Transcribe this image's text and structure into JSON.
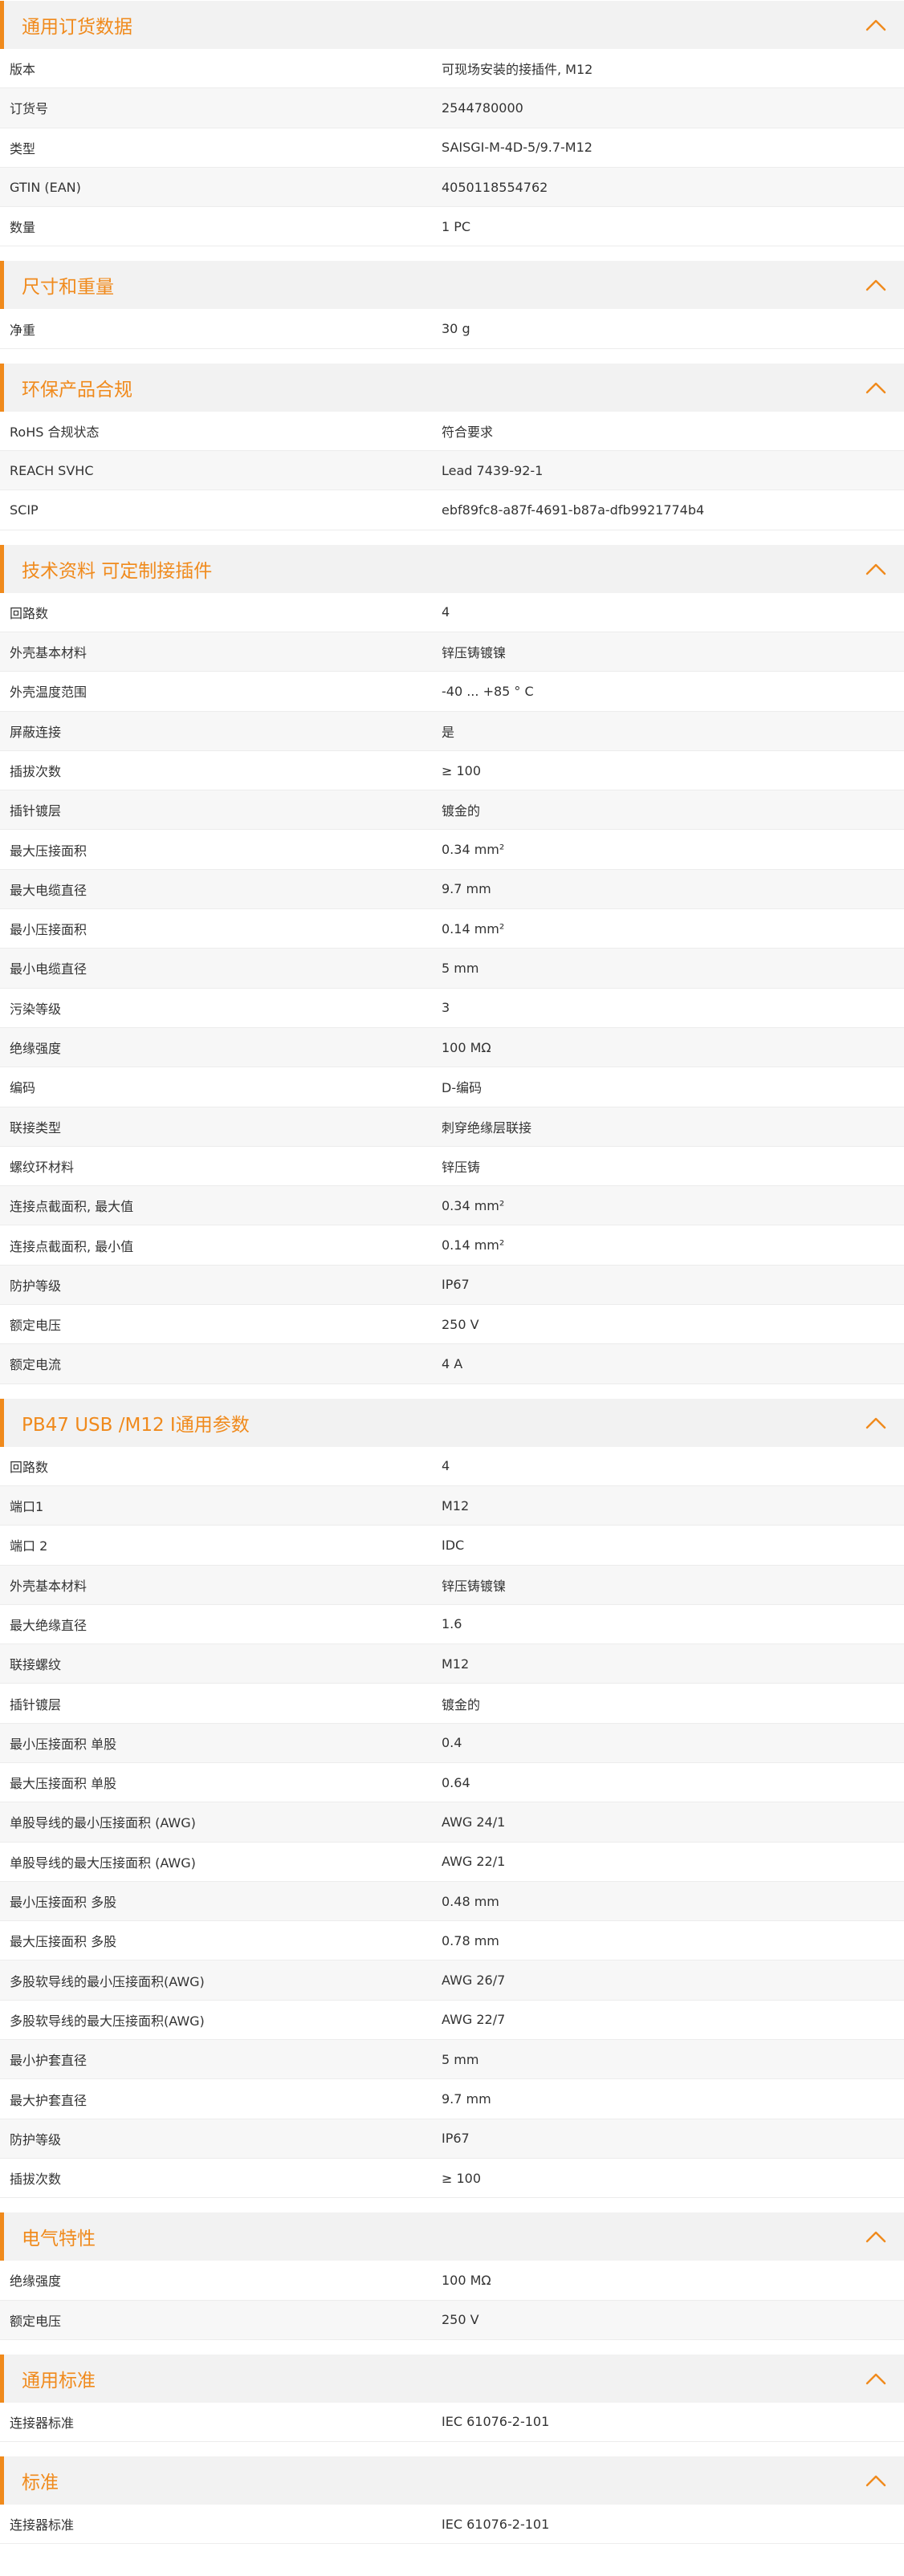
{
  "accent_color": "#f08a1c",
  "chevron_icon": "chevron-up-icon",
  "sections": [
    {
      "title": "通用订货数据",
      "rows": [
        {
          "label": "版本",
          "value": "可现场安装的接插件, M12"
        },
        {
          "label": "订货号",
          "value": "2544780000"
        },
        {
          "label": "类型",
          "value": "SAISGI-M-4D-5/9.7-M12"
        },
        {
          "label": "GTIN (EAN)",
          "value": "4050118554762"
        },
        {
          "label": "数量",
          "value": "1  PC"
        }
      ]
    },
    {
      "title": "尺寸和重量",
      "rows": [
        {
          "label": "净重",
          "value": "30  g"
        }
      ]
    },
    {
      "title": "环保产品合规",
      "rows": [
        {
          "label": "RoHS 合规状态",
          "value": "符合要求"
        },
        {
          "label": "REACH SVHC",
          "value": "Lead 7439-92-1"
        },
        {
          "label": "SCIP",
          "value": "ebf89fc8-a87f-4691-b87a-dfb9921774b4"
        }
      ]
    },
    {
      "title": "技术资料 可定制接插件",
      "rows": [
        {
          "label": "回路数",
          "value": "4"
        },
        {
          "label": "外壳基本材料",
          "value": "锌压铸镀镍"
        },
        {
          "label": "外壳温度范围",
          "value": "-40 ... +85 ° C"
        },
        {
          "label": "屏蔽连接",
          "value": "是"
        },
        {
          "label": "插拔次数",
          "value": "≥ 100"
        },
        {
          "label": "插针镀层",
          "value": "镀金的"
        },
        {
          "label": "最大压接面积",
          "value": "0.34  mm²"
        },
        {
          "label": "最大电缆直径",
          "value": "9.7  mm"
        },
        {
          "label": "最小压接面积",
          "value": "0.14  mm²"
        },
        {
          "label": "最小电缆直径",
          "value": "5  mm"
        },
        {
          "label": "污染等级",
          "value": "3"
        },
        {
          "label": "绝缘强度",
          "value": "100 MΩ"
        },
        {
          "label": "编码",
          "value": "D-编码"
        },
        {
          "label": "联接类型",
          "value": "刺穿绝缘层联接"
        },
        {
          "label": "螺纹环材料",
          "value": "锌压铸"
        },
        {
          "label": "连接点截面积, 最大值",
          "value": "0.34  mm²"
        },
        {
          "label": "连接点截面积, 最小值",
          "value": "0.14  mm²"
        },
        {
          "label": "防护等级",
          "value": "IP67"
        },
        {
          "label": "额定电压",
          "value": "250  V"
        },
        {
          "label": "额定电流",
          "value": "4  A"
        }
      ]
    },
    {
      "title": "PB47 USB /M12 I通用参数",
      "rows": [
        {
          "label": "回路数",
          "value": "4"
        },
        {
          "label": "端口1",
          "value": "M12"
        },
        {
          "label": "端口 2",
          "value": "IDC"
        },
        {
          "label": "外壳基本材料",
          "value": "锌压铸镀镍"
        },
        {
          "label": "最大绝缘直径",
          "value": "1.6"
        },
        {
          "label": "联接螺纹",
          "value": "M12"
        },
        {
          "label": "插针镀层",
          "value": "镀金的"
        },
        {
          "label": "最小压接面积 单股",
          "value": "0.4"
        },
        {
          "label": "最大压接面积 单股",
          "value": "0.64"
        },
        {
          "label": "单股导线的最小压接面积 (AWG)",
          "value": "AWG 24/1"
        },
        {
          "label": "单股导线的最大压接面积 (AWG)",
          "value": "AWG 22/1"
        },
        {
          "label": "最小压接面积 多股",
          "value": "0.48  mm"
        },
        {
          "label": "最大压接面积 多股",
          "value": "0.78  mm"
        },
        {
          "label": "多股软导线的最小压接面积(AWG)",
          "value": "AWG 26/7"
        },
        {
          "label": "多股软导线的最大压接面积(AWG)",
          "value": "AWG 22/7"
        },
        {
          "label": "最小护套直径",
          "value": "5  mm"
        },
        {
          "label": "最大护套直径",
          "value": "9.7  mm"
        },
        {
          "label": "防护等级",
          "value": "IP67"
        },
        {
          "label": "插拔次数",
          "value": "≥ 100"
        }
      ]
    },
    {
      "title": "电气特性",
      "rows": [
        {
          "label": "绝缘强度",
          "value": "100 MΩ"
        },
        {
          "label": "额定电压",
          "value": "250  V"
        }
      ]
    },
    {
      "title": "通用标准",
      "rows": [
        {
          "label": "连接器标准",
          "value": "IEC 61076-2-101"
        }
      ]
    },
    {
      "title": "标准",
      "rows": [
        {
          "label": "连接器标准",
          "value": "IEC 61076-2-101"
        }
      ]
    }
  ]
}
